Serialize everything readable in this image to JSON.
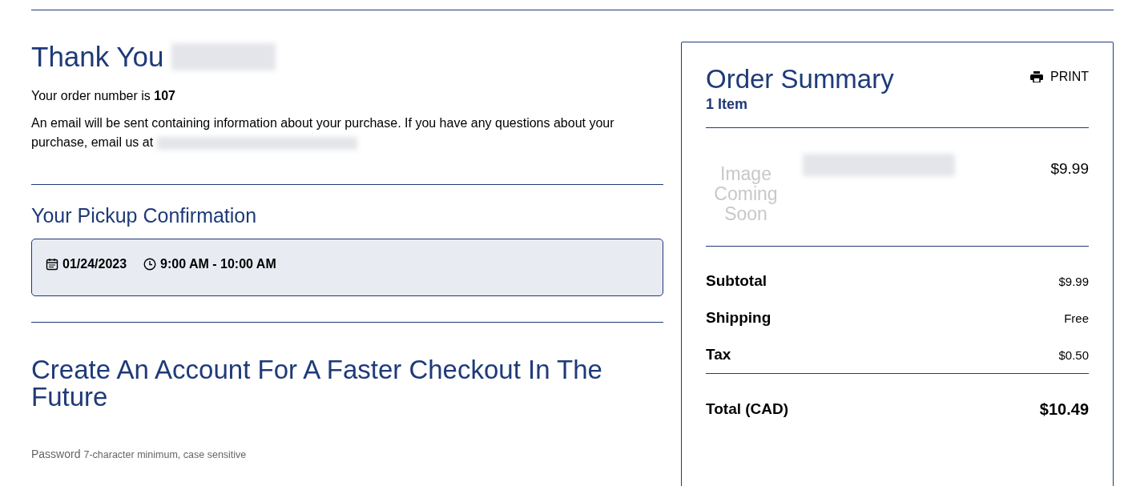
{
  "thank_you": {
    "title": "Thank You"
  },
  "order_number": "Your order number is **107**",
  "email_notice": "An email will be sent containing information about your purchase. If you have any questions about your purchase, email us at",
  "pickup": {
    "title": "Your Pickup Confirmation",
    "date": "01/24/2023",
    "time": "9:00 AM - 10:00 AM"
  },
  "account": {
    "title": "Create An Account For A Faster Checkout In The Future",
    "password_label": "Password",
    "password_hint": "7-character minimum, case sensitive"
  },
  "summary": {
    "title": "Order Summary",
    "count": "1 Item",
    "print": "PRINT",
    "items": [
      {
        "image_text": "Image Coming Soon",
        "price": "$9.99"
      }
    ],
    "rows": [
      {
        "label": "Subtotal",
        "value": "$9.99"
      },
      {
        "label": "Shipping",
        "value": "Free"
      },
      {
        "label": "Tax",
        "value": "$0.50"
      }
    ],
    "total": {
      "label": "Total (CAD)",
      "value": "$10.49"
    }
  }
}
